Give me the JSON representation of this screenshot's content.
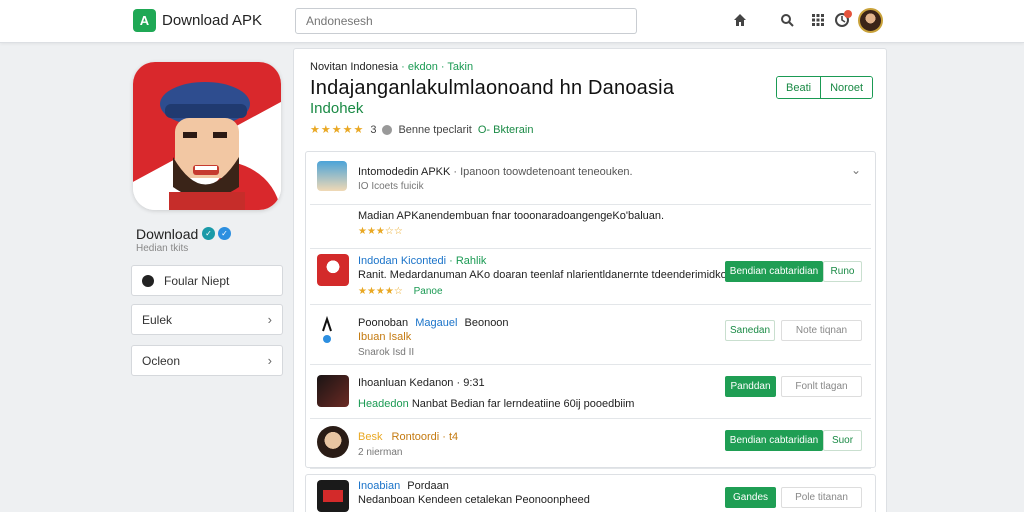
{
  "header": {
    "logo_glyph": "A",
    "title": "Download APK",
    "search_placeholder": "Andonesesh",
    "icons": [
      "home-icon",
      "search-icon",
      "grid-icon",
      "notification-icon",
      "user-avatar"
    ]
  },
  "sidebar": {
    "app_name": "Download",
    "app_sub": "Hedian tkits",
    "buttons": [
      {
        "label": "Foular Niept"
      },
      {
        "label": "Eulek"
      },
      {
        "label": "Ocleon"
      }
    ]
  },
  "main": {
    "kicker": "Novitan Indonesia",
    "kicker_green": "· ekdon · Takin",
    "title": "Indajanganlakulmlaonoand hn Danoasia",
    "subtitle": "Indohek",
    "rating_stars": "★★★★★",
    "rating_count": "3",
    "meta": "Benne tpeclarit",
    "category": "O- Bkterain",
    "btn_primary": "Beati",
    "btn_secondary": "Noroet"
  },
  "list": {
    "header_title": "Intomodedin APKK",
    "header_desc": "· Ipanoon toowdetenoant teneouken.",
    "header_sub": "IO Icoets fuicik",
    "intro": "Madian APKanendembuan fnar tooonaradoangengeKo'baluan.",
    "intro_stars": "★★★☆☆",
    "rows": [
      {
        "title": "Indodan Kicontedi",
        "title_tag": "· Rahlik",
        "desc": "Ranit. Medardanuman AKo doaran teenlaf nlarientldanernte tdeenderimidkoec?",
        "stars": "★★★★☆",
        "tag": "Panoe",
        "btn1": "Bendian cabtaridian",
        "btn2": "Runo"
      },
      {
        "title": "Poonoban",
        "title_mid": "Magauel",
        "title_end": "Beonoon",
        "desc": "Ibuan Isalk",
        "sub": "Snarok Isd II",
        "btn1": "Sanedan",
        "btn2": "Note tiqnan"
      },
      {
        "title": "Ihoanluan Kedanon · 9:31",
        "desc_green": "Headedon",
        "desc": "Nanbat Bedian far lerndeatiine 60ij pooedbiim",
        "btn1": "Panddan",
        "btn2": "Fonlt tlagan"
      },
      {
        "title": "Besk",
        "title_rest": "Rontoordi · t4",
        "sub": "2 nierman",
        "btn1": "Bendian cabtaridian",
        "btn2": "Suor"
      },
      {
        "title": "Inoabian",
        "title_rest": "Pordaan",
        "desc": "Nedanboan Kendeen cetalekan Peonoonpheed",
        "btn1": "Gandes",
        "btn2": "Pole titanan"
      }
    ]
  },
  "colors": {
    "accent": "#1f9e54",
    "star": "#e9a824"
  }
}
